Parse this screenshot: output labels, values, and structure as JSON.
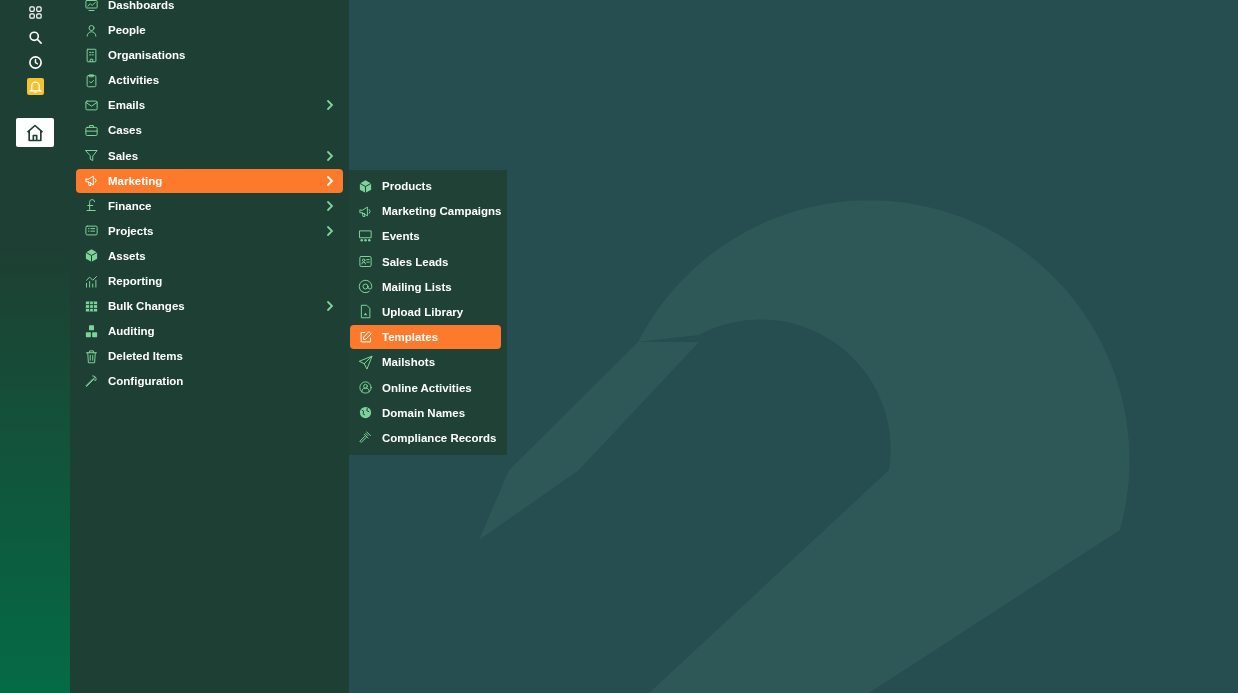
{
  "rail": [
    {
      "selected": false,
      "alert": false
    },
    {
      "selected": false,
      "alert": false
    },
    {
      "selected": false,
      "alert": false
    },
    {
      "selected": false,
      "alert": true
    },
    {
      "selected": true,
      "alert": false
    }
  ],
  "menu": [
    {
      "label": "Dashboards",
      "selected": false,
      "has_submenu": false
    },
    {
      "label": "People",
      "selected": false,
      "has_submenu": false
    },
    {
      "label": "Organisations",
      "selected": false,
      "has_submenu": false
    },
    {
      "label": "Activities",
      "selected": false,
      "has_submenu": false
    },
    {
      "label": "Emails",
      "selected": false,
      "has_submenu": true
    },
    {
      "label": "Cases",
      "selected": false,
      "has_submenu": false
    },
    {
      "label": "Sales",
      "selected": false,
      "has_submenu": true
    },
    {
      "label": "Marketing",
      "selected": true,
      "has_submenu": true
    },
    {
      "label": "Finance",
      "selected": false,
      "has_submenu": true
    },
    {
      "label": "Projects",
      "selected": false,
      "has_submenu": true
    },
    {
      "label": "Assets",
      "selected": false,
      "has_submenu": false
    },
    {
      "label": "Reporting",
      "selected": false,
      "has_submenu": false
    },
    {
      "label": "Bulk Changes",
      "selected": false,
      "has_submenu": true
    },
    {
      "label": "Auditing",
      "selected": false,
      "has_submenu": false
    },
    {
      "label": "Deleted Items",
      "selected": false,
      "has_submenu": false
    },
    {
      "label": "Configuration",
      "selected": false,
      "has_submenu": false
    }
  ],
  "submenu": [
    {
      "label": "Products",
      "selected": false
    },
    {
      "label": "Marketing Campaigns",
      "selected": false
    },
    {
      "label": "Events",
      "selected": false
    },
    {
      "label": "Sales Leads",
      "selected": false
    },
    {
      "label": "Mailing Lists",
      "selected": false
    },
    {
      "label": "Upload Library",
      "selected": false
    },
    {
      "label": "Templates",
      "selected": true
    },
    {
      "label": "Mailshots",
      "selected": false
    },
    {
      "label": "Online Activities",
      "selected": false
    },
    {
      "label": "Domain Names",
      "selected": false
    },
    {
      "label": "Compliance Records",
      "selected": false
    }
  ]
}
